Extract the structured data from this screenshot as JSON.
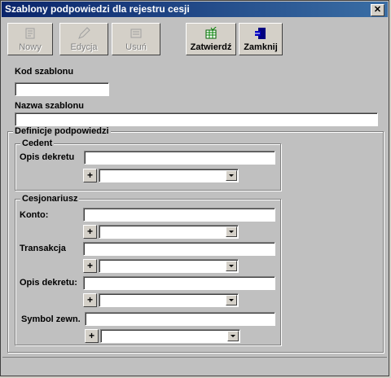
{
  "window": {
    "title": "Szablony podpowiedzi dla rejestru cesji",
    "close_label": "✕"
  },
  "toolbar": {
    "buttons": [
      {
        "label": "Nowy",
        "icon": "new-document-icon",
        "enabled": false
      },
      {
        "label": "Edycja",
        "icon": "pencil-icon",
        "enabled": false
      },
      {
        "label": "Usuń",
        "icon": "delete-icon",
        "enabled": false
      },
      {
        "label": "Zatwierdź",
        "icon": "table-check-icon",
        "enabled": true
      },
      {
        "label": "Zamknij",
        "icon": "exit-door-icon",
        "enabled": true
      }
    ]
  },
  "form": {
    "kod_label": "Kod szablonu",
    "kod_value": "",
    "nazwa_label": "Nazwa szablonu",
    "nazwa_value": "",
    "definicje_label": "Definicje podpowiedzi",
    "cedent": {
      "label": "Cedent",
      "opis_label": "Opis dekretu",
      "opis_value": "",
      "plus": "+",
      "combo_value": ""
    },
    "cesjonariusz": {
      "label": "Cesjonariusz",
      "konto_label": "Konto:",
      "transakcja_label": "Transakcja",
      "opis_label": "Opis dekretu:",
      "symbol_label": "Symbol zewn.",
      "plus": "+"
    }
  },
  "colors": {
    "window_bg": "#c0c0c0",
    "title_bg": "#0a246a"
  }
}
